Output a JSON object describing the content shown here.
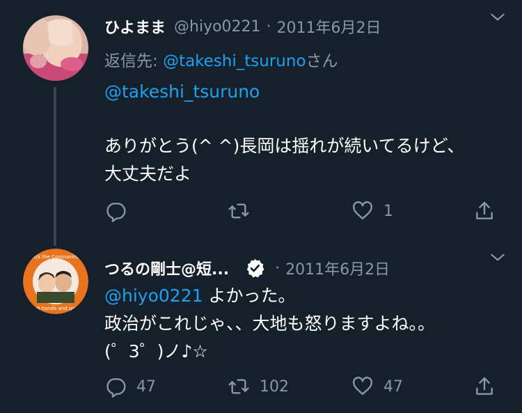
{
  "tweets": [
    {
      "name": "ひよまま",
      "handle": "@hiyo0221",
      "separator": "·",
      "date": "2011年6月2日",
      "reply_prefix": "返信先: ",
      "reply_handle": "@takeshi_tsuruno",
      "reply_suffix": "さん",
      "body_mention": "@takeshi_tsuruno",
      "body_lines": [
        "ありがとう(^ ^)長岡は揺れが続いてるけど、",
        "大丈夫だよ"
      ],
      "counts": {
        "reply": "",
        "retweet": "",
        "like": "1"
      }
    },
    {
      "name": "つるの剛士@短...",
      "date_separator": "·",
      "date": "2011年6月2日",
      "mention": "@hiyo0221",
      "mention_tail": " よかった。",
      "body_lines": [
        "政治がこれじゃ、、大地も怒りますよね。。",
        "(゜3゜)ノ♪☆"
      ],
      "avatar_badge_text": "Kick the Coronavirus Wash hands and gargle",
      "counts": {
        "reply": "47",
        "retweet": "102",
        "like": "47"
      }
    }
  ],
  "icons": {
    "reply": "reply-icon",
    "retweet": "retweet-icon",
    "like": "heart-icon",
    "share": "share-icon",
    "more": "chevron-down-icon",
    "verified": "verified-badge-icon"
  },
  "colors": {
    "background": "#15202b",
    "text": "#ffffff",
    "muted": "#8899a6",
    "link": "#1da1f2",
    "thread_line": "#38444d",
    "badge_ring": "#e8741f"
  }
}
